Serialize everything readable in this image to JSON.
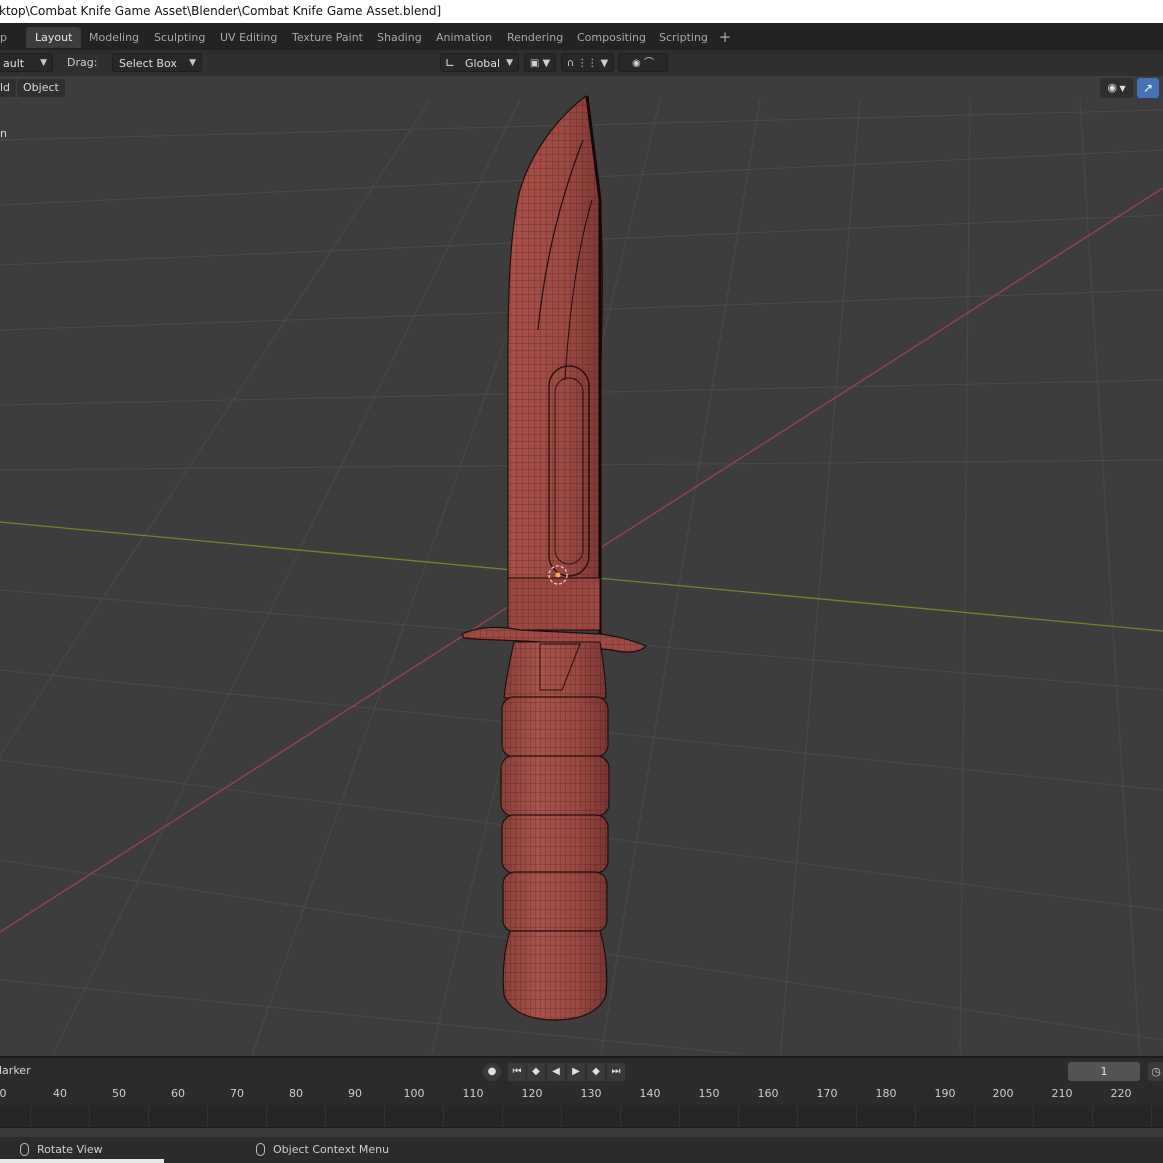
{
  "window": {
    "title": "ktop\\Combat Knife Game Asset\\Blender\\Combat Knife Game Asset.blend]"
  },
  "workspaces": {
    "stub": "p",
    "tabs": [
      "Layout",
      "Modeling",
      "Sculpting",
      "UV Editing",
      "Texture Paint",
      "Shading",
      "Animation",
      "Rendering",
      "Compositing",
      "Scripting"
    ],
    "active": "Layout",
    "add_label": "+"
  },
  "header": {
    "mode_value": "ault",
    "drag_label": "Drag:",
    "drag_value": "Select Box",
    "orientation_value": "Global"
  },
  "menus": {
    "item1": "ld",
    "item2": "Object",
    "side_text": "n"
  },
  "viewport": {
    "object": "Combat Knife",
    "colors": {
      "background": "#3d3d3d",
      "grid": "#4a4a4a",
      "x_axis": "#a3404f",
      "y_axis": "#6b8a2c",
      "mesh": "#9e4a44",
      "wire": "#1e0d0b",
      "origin": "#f0b060"
    }
  },
  "timeline": {
    "marker_label": "larker",
    "current_frame": "1",
    "ruler_labels": [
      "0",
      "40",
      "50",
      "60",
      "70",
      "80",
      "90",
      "100",
      "110",
      "120",
      "130",
      "140",
      "150",
      "160",
      "170",
      "180",
      "190",
      "200",
      "210",
      "220"
    ]
  },
  "status": {
    "left_action": "Rotate View",
    "right_action": "Object Context Menu"
  }
}
